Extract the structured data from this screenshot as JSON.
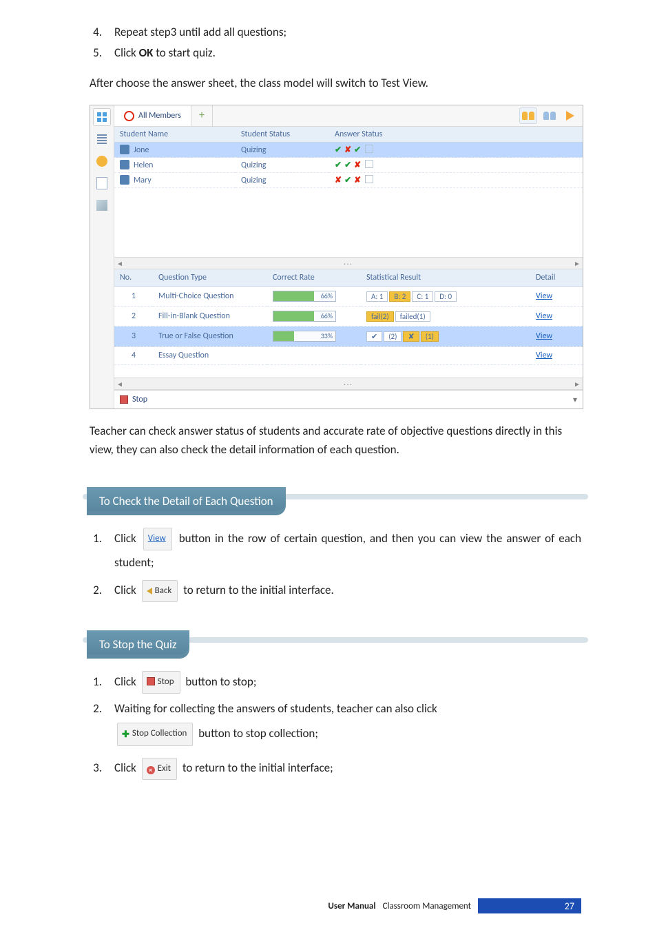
{
  "steps_top": [
    {
      "num": "4.",
      "text_before": "Repeat step3 until add all questions;",
      "bold": ""
    },
    {
      "num": "5.",
      "text_before": "Click ",
      "bold": "OK",
      "text_after": " to start quiz."
    }
  ],
  "para_after_steps": "After choose the answer sheet, the class model will switch to Test View.",
  "app": {
    "tab_label": "All Members",
    "upper": {
      "headers": {
        "name": "Student Name",
        "status": "Student Status",
        "answer": "Answer Status"
      },
      "rows": [
        {
          "name": "Jone",
          "status": "Quizing",
          "answer": [
            "check",
            "cross",
            "check",
            "sq"
          ],
          "selected": true
        },
        {
          "name": "Helen",
          "status": "Quizing",
          "answer": [
            "check",
            "check",
            "cross",
            "sq"
          ]
        },
        {
          "name": "Mary",
          "status": "Quizing",
          "answer": [
            "cross",
            "check",
            "cross",
            "sq"
          ]
        }
      ]
    },
    "lower": {
      "headers": {
        "no": "No.",
        "qtype": "Question Type",
        "rate": "Correct Rate",
        "result": "Statistical Result",
        "detail": "Detail"
      },
      "rows": [
        {
          "no": "1",
          "qtype": "Multi-Choice Question",
          "rate_pct": 66,
          "rate_label": "66%",
          "result_kind": "multi",
          "result": [
            {
              "t": "A: 1"
            },
            {
              "t": "B: 2",
              "hi": true
            },
            {
              "t": "C: 1"
            },
            {
              "t": "D: 0"
            }
          ],
          "detail": "View"
        },
        {
          "no": "2",
          "qtype": "Fill-in-Blank Question",
          "rate_pct": 66,
          "rate_label": "66%",
          "result_kind": "fill",
          "result": [
            {
              "t": "fail(2)",
              "hi": true
            },
            {
              "t": "failed(1)"
            }
          ],
          "detail": "View"
        },
        {
          "no": "3",
          "qtype": "True or False Question",
          "rate_pct": 33,
          "rate_label": "33%",
          "result_kind": "tf",
          "result": [
            {
              "t": "✔"
            },
            {
              "t": "(2)"
            },
            {
              "t": "✘",
              "hi": true
            },
            {
              "t": "(1)",
              "hi": true
            }
          ],
          "detail": "View",
          "selected": true
        },
        {
          "no": "4",
          "qtype": "Essay Question",
          "rate_pct": null,
          "rate_label": "",
          "result_kind": "none",
          "result": [],
          "detail": "View"
        }
      ]
    },
    "statusbar": "Stop"
  },
  "para_below_app": "Teacher can check answer status of students and accurate rate of objective questions directly in this view, they can also check the detail information of each question.",
  "heading_detail": "To Check the Detail of Each Question",
  "detail_steps": {
    "s1_a": "Click ",
    "s1_btn": "View",
    "s1_b": " button in the row of certain question, and then you can view the answer of each student;",
    "s2_a": "Click ",
    "s2_btn": "Back",
    "s2_b": " to return to the initial interface."
  },
  "heading_stop": "To Stop the Quiz",
  "stop_steps": {
    "s1_a": "Click ",
    "s1_btn": "Stop",
    "s1_b": " button to stop;",
    "s2": "Waiting for collecting the answers of students, teacher can also click ",
    "s2_btn": "Stop Collection",
    "s2_b": " button to stop collection;",
    "s3_a": "Click ",
    "s3_btn": "Exit",
    "s3_b": " to return to the initial interface;"
  },
  "footer": {
    "label": "User Manual",
    "product": "Classroom Management",
    "page": "27"
  }
}
